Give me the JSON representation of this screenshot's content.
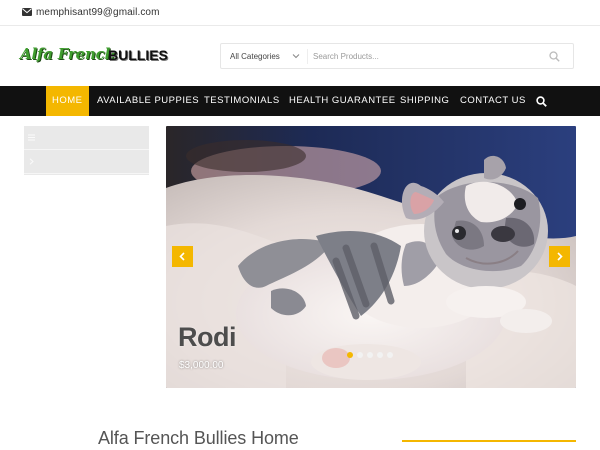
{
  "topbar": {
    "email": "memphisant99@gmail.com",
    "icon": "envelope-icon"
  },
  "header": {
    "logo": {
      "script_text": "Alfa French",
      "bold_text": "BULLIES"
    },
    "search": {
      "category": "All Categories",
      "placeholder": "Search Products...",
      "value": "",
      "icon": "search-icon"
    }
  },
  "nav": {
    "items": [
      {
        "label": "HOME",
        "active": true
      },
      {
        "label": "AVAILABLE PUPPIES",
        "active": false
      },
      {
        "label": "TESTIMONIALS",
        "active": false
      },
      {
        "label": "HEALTH GUARANTEE",
        "active": false
      },
      {
        "label": "SHIPPING",
        "active": false
      },
      {
        "label": "CONTACT US",
        "active": false
      }
    ],
    "search_icon": "search-icon"
  },
  "sidebar": {
    "items": [
      {
        "label": "",
        "icon": "menu-icon"
      },
      {
        "label": "",
        "icon": "chevron-right-icon"
      }
    ]
  },
  "slider": {
    "slide_title": "Rodi",
    "slide_price": "$3,000.00",
    "dots": {
      "count": 5,
      "active_index": 0
    },
    "prev_icon": "chevron-left-icon",
    "next_icon": "chevron-right-icon"
  },
  "main": {
    "title": "Alfa French Bullies Home"
  },
  "colors": {
    "accent": "#f4b700",
    "nav_bg": "#111111",
    "logo_green": "#3f9d2f"
  }
}
